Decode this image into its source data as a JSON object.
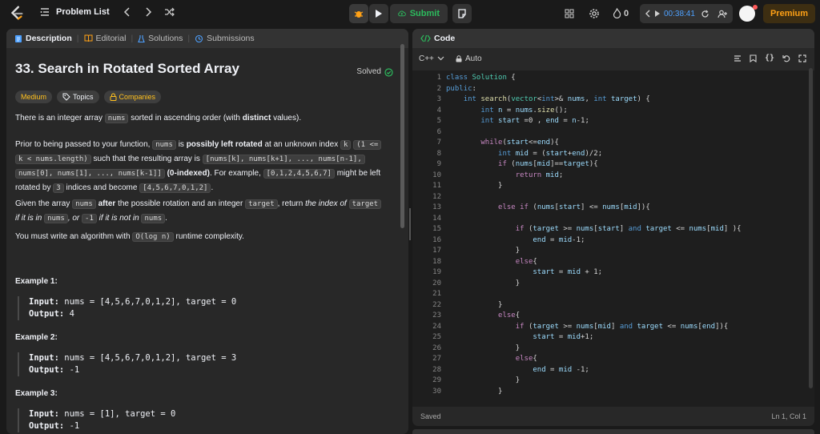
{
  "topbar": {
    "problem_list": "Problem List",
    "submit": "Submit",
    "streak": "0",
    "timer": "00:38:41",
    "premium": "Premium"
  },
  "left_tabs": {
    "description": "Description",
    "editorial": "Editorial",
    "solutions": "Solutions",
    "submissions": "Submissions"
  },
  "problem": {
    "title": "33. Search in Rotated Sorted Array",
    "solved": "Solved",
    "badges": {
      "difficulty": "Medium",
      "topics": "Topics",
      "companies": "Companies"
    },
    "p1": {
      "a": "There is an integer array",
      "b": "nums",
      "c": "sorted in ascending order (with",
      "d": "distinct",
      "e": "values)."
    },
    "p2": {
      "a": "Prior to being passed to your function,",
      "b": "nums",
      "c": "is",
      "d": "possibly left rotated",
      "e": "at an unknown index",
      "f": "k",
      "g": "(1 <=",
      "h": "k < nums.length)",
      "i": "such that the resulting array is",
      "j": "[nums[k], nums[k+1], ..., nums[n-1],",
      "k": "nums[0], nums[1], ..., nums[k-1]]",
      "l": "(0-indexed)",
      "m": ". For example,",
      "n": "[0,1,2,4,5,6,7]",
      "o": "might be left",
      "p": "rotated by",
      "q": "3",
      "r": "indices and become",
      "s": "[4,5,6,7,0,1,2]",
      "t": "."
    },
    "p3": {
      "a": "Given the array",
      "b": "nums",
      "c": "after",
      "d": "the possible rotation and an integer",
      "e": "target",
      "f": ", return",
      "g": "the index of",
      "h": "target",
      "i": "if it is in",
      "j": "nums",
      "k": ", or",
      "l": "-1",
      "m": "if it is not in",
      "n": "nums",
      "o": "."
    },
    "p4": {
      "a": "You must write an algorithm with",
      "b": "O(log n)",
      "c": "runtime complexity."
    },
    "examples": [
      {
        "heading": "Example 1:",
        "input_label": "Input:",
        "input": "nums = [4,5,6,7,0,1,2], target = 0",
        "output_label": "Output:",
        "output": "4"
      },
      {
        "heading": "Example 2:",
        "input_label": "Input:",
        "input": "nums = [4,5,6,7,0,1,2], target = 3",
        "output_label": "Output:",
        "output": "-1"
      },
      {
        "heading": "Example 3:",
        "input_label": "Input:",
        "input": "nums = [1], target = 0",
        "output_label": "Output:",
        "output": "-1"
      }
    ]
  },
  "code_panel": {
    "title": "Code",
    "language": "C++",
    "mode": "Auto",
    "status_left": "Saved",
    "status_right": "Ln 1, Col 1",
    "lines": [
      "class Solution {",
      "public:",
      "    int search(vector<int>& nums, int target) {",
      "        int n = nums.size();",
      "        int start =0 , end = n-1;",
      "",
      "        while(start<=end){",
      "            int mid = (start+end)/2;",
      "            if (nums[mid]==target){",
      "                return mid;",
      "            }",
      "",
      "            else if (nums[start] <= nums[mid]){",
      "",
      "                if (target >= nums[start] and target <= nums[mid] ){",
      "                    end = mid-1;",
      "                }",
      "                else{",
      "                    start = mid + 1;",
      "                }",
      "",
      "            }",
      "            else{",
      "                if (target >= nums[mid] and target <= nums[end]){",
      "                    start = mid+1;",
      "                }",
      "                else{",
      "                    end = mid -1;",
      "                }",
      "            }"
    ]
  }
}
